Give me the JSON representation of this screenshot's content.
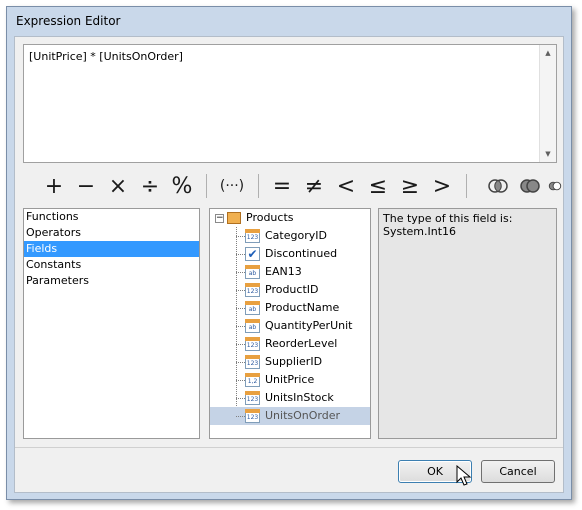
{
  "window": {
    "title": "Expression Editor"
  },
  "editor": {
    "text": "[UnitPrice] * [UnitsOnOrder]"
  },
  "operators": {
    "plus": "+",
    "minus": "−",
    "multiply": "×",
    "divide": "÷",
    "modulo": "%",
    "brackets": "(···)",
    "equal": "=",
    "not_equal": "≠",
    "less": "<",
    "less_equal": "≤",
    "greater_equal": "≥",
    "greater": ">"
  },
  "categories": [
    {
      "label": "Functions",
      "selected": false
    },
    {
      "label": "Operators",
      "selected": false
    },
    {
      "label": "Fields",
      "selected": true
    },
    {
      "label": "Constants",
      "selected": false
    },
    {
      "label": "Parameters",
      "selected": false
    }
  ],
  "tree": {
    "root": "Products",
    "fields": [
      {
        "label": "CategoryID",
        "icon": "123"
      },
      {
        "label": "Discontinued",
        "icon": "check"
      },
      {
        "label": "EAN13",
        "icon": "ab"
      },
      {
        "label": "ProductID",
        "icon": "123"
      },
      {
        "label": "ProductName",
        "icon": "ab"
      },
      {
        "label": "QuantityPerUnit",
        "icon": "ab"
      },
      {
        "label": "ReorderLevel",
        "icon": "123"
      },
      {
        "label": "SupplierID",
        "icon": "123"
      },
      {
        "label": "UnitPrice",
        "icon": "1,2"
      },
      {
        "label": "UnitsInStock",
        "icon": "123"
      },
      {
        "label": "UnitsOnOrder",
        "icon": "123"
      }
    ]
  },
  "description": {
    "line1": "The type of this field is:",
    "line2": "System.Int16"
  },
  "buttons": {
    "ok": "OK",
    "cancel": "Cancel"
  },
  "colors": {
    "selection": "#3399ff",
    "tree_selection": "#c5d3e6"
  }
}
